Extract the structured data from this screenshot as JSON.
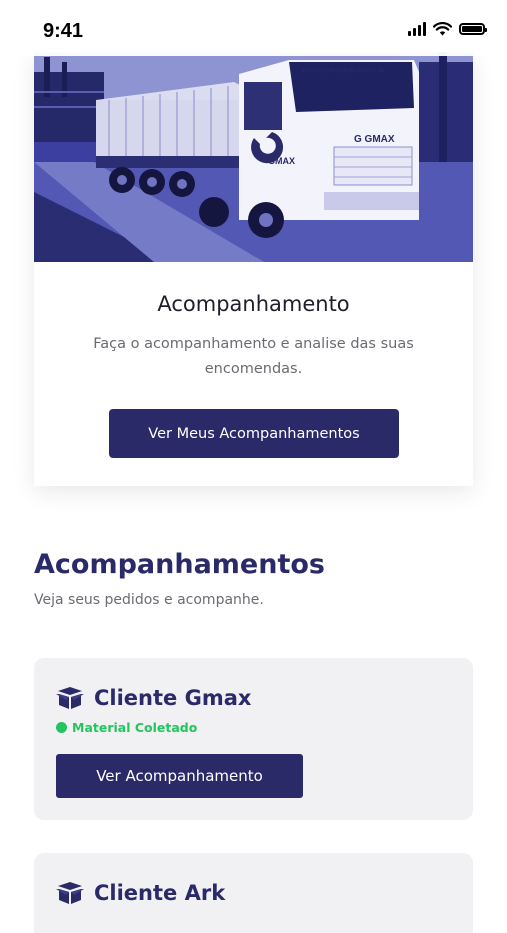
{
  "status_bar": {
    "time": "9:41"
  },
  "hero": {
    "title": "Acompanhamento",
    "description": "Faça o acompanhamento e analise das suas encomendas.",
    "button_label": "Ver Meus Acompanhamentos",
    "truck_brand": "GMAX"
  },
  "section": {
    "title": "Acompanhamentos",
    "subtitle": "Veja seus pedidos e acompanhe."
  },
  "clients": [
    {
      "name": "Cliente Gmax",
      "status": "Material Coletado",
      "button_label": "Ver Acompanhamento"
    },
    {
      "name": "Cliente Ark"
    }
  ],
  "colors": {
    "primary": "#2b2a69",
    "status_green": "#22c55e",
    "card_bg": "#f1f1f3",
    "muted_text": "#6b6b72"
  }
}
